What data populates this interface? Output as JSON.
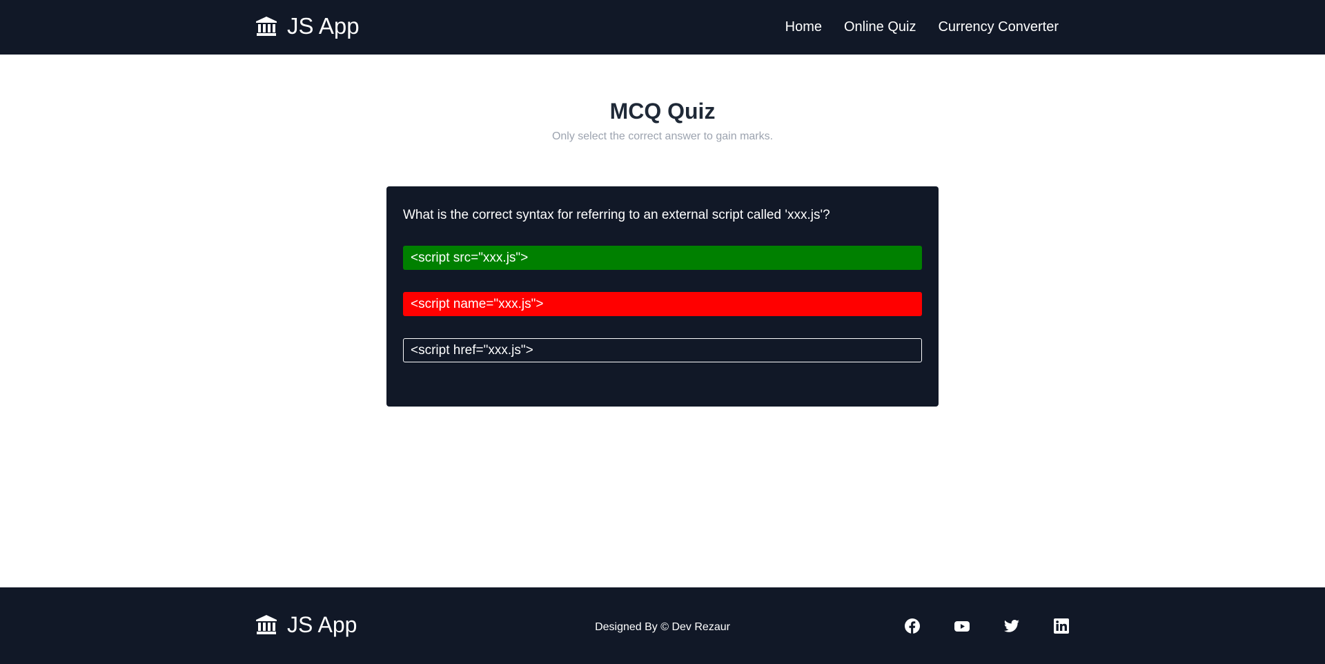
{
  "header": {
    "brand": "JS App",
    "brand_icon": "bank-icon",
    "nav": [
      {
        "label": "Home"
      },
      {
        "label": "Online Quiz"
      },
      {
        "label": "Currency Converter"
      }
    ]
  },
  "hero": {
    "title": "MCQ Quiz",
    "subtitle": "Only select the correct answer to gain marks."
  },
  "quiz": {
    "question": "What is the correct syntax for referring to an external script called 'xxx.js'?",
    "options": [
      {
        "label": "<script src=\"xxx.js\">",
        "state": "correct",
        "color": "#008000"
      },
      {
        "label": "<script name=\"xxx.js\">",
        "state": "wrong",
        "color": "#ff0000"
      },
      {
        "label": "<script href=\"xxx.js\">",
        "state": "unselected"
      }
    ]
  },
  "footer": {
    "brand": "JS App",
    "credit": "Designed By  © Dev Rezaur",
    "socials": [
      {
        "icon": "facebook-icon"
      },
      {
        "icon": "youtube-icon"
      },
      {
        "icon": "twitter-icon"
      },
      {
        "icon": "linkedin-icon"
      }
    ]
  },
  "colors": {
    "dark": "#111827",
    "correct": "#008000",
    "wrong": "#ff0000",
    "subtitle": "#9ca3af"
  }
}
